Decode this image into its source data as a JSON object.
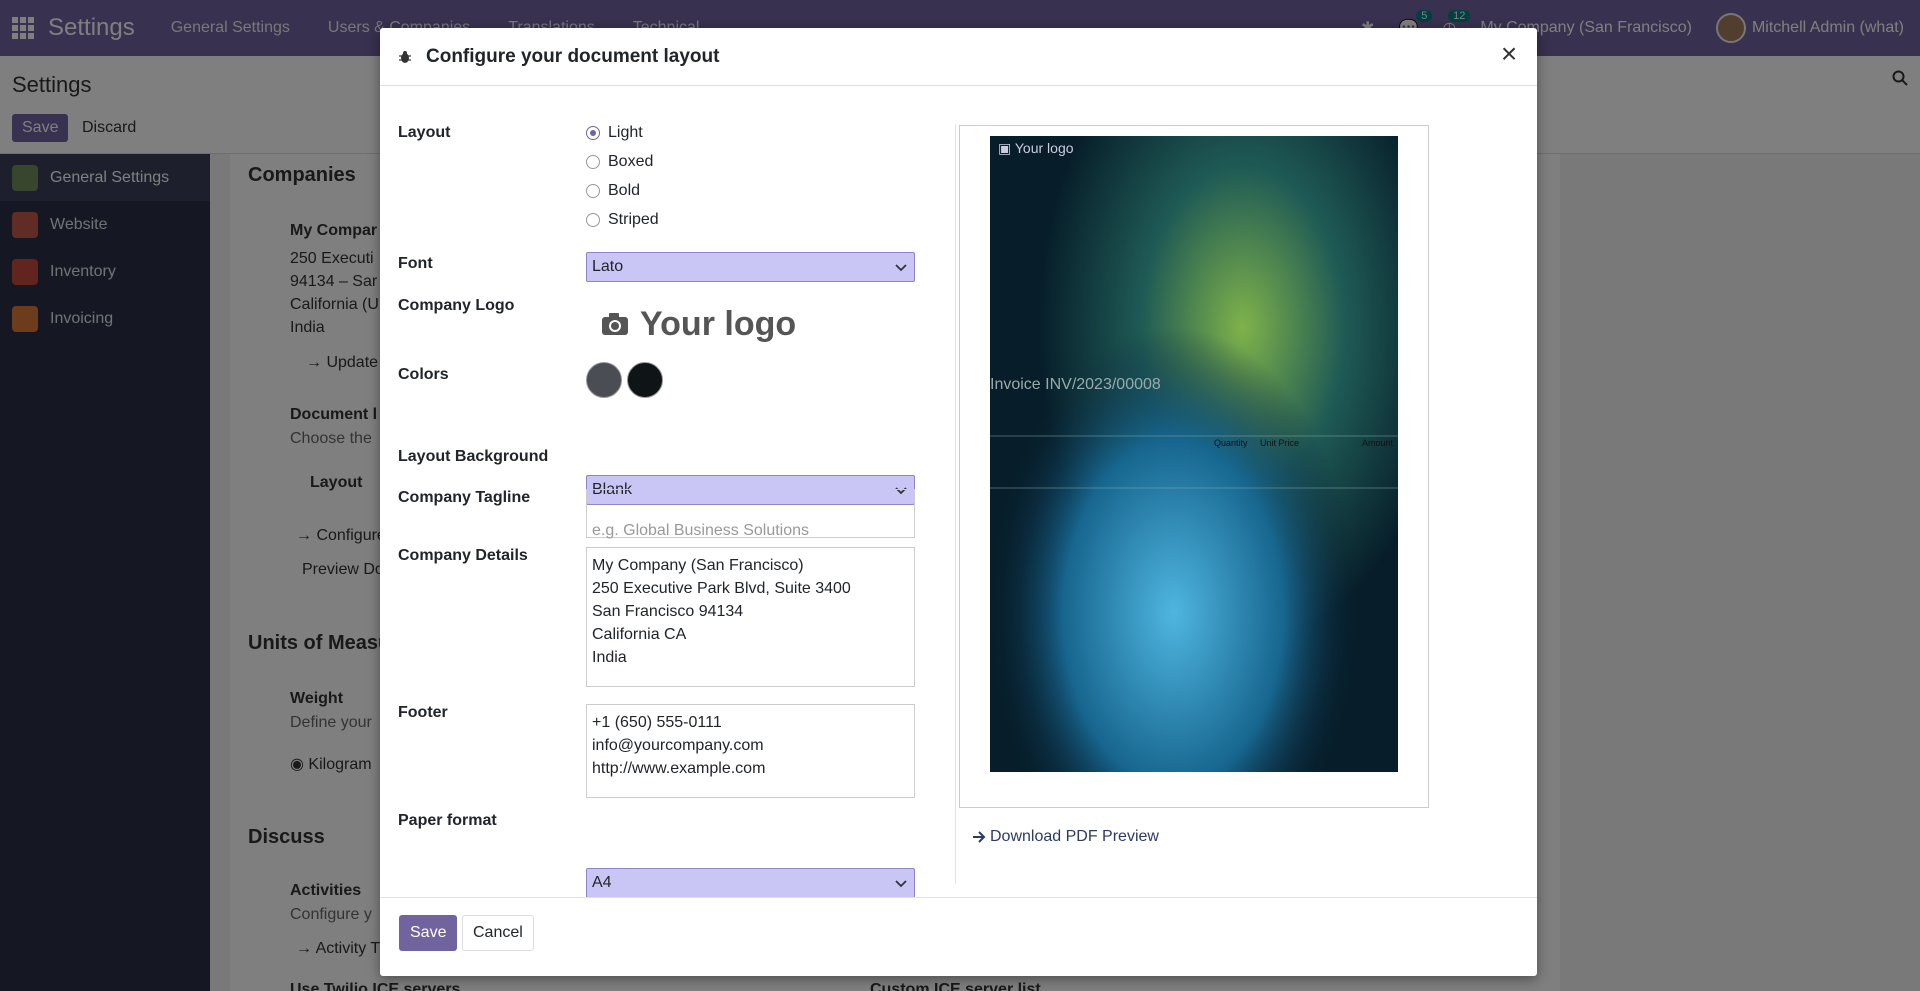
{
  "navbar": {
    "brand": "Settings",
    "menus": [
      "General Settings",
      "Users & Companies",
      "Translations",
      "Technical"
    ],
    "messages_count": "5",
    "activities_count": "12",
    "company": "My Company (San Francisco)",
    "user": "Mitchell Admin (what)"
  },
  "control_panel": {
    "title": "Settings",
    "save_label": "Save",
    "discard_label": "Discard"
  },
  "sidebar": {
    "items": [
      {
        "label": "General Settings",
        "color": "#6e8c5a"
      },
      {
        "label": "Website",
        "color": "#c0584a"
      },
      {
        "label": "Inventory",
        "color": "#c44a3a"
      },
      {
        "label": "Invoicing",
        "color": "#d9783a"
      }
    ]
  },
  "background": {
    "companies_heading": "Companies",
    "company_name": "My Compar",
    "address_lines": [
      "250 Executi",
      "94134 – Sar",
      "California (U",
      "India"
    ],
    "update_link": "Update",
    "doc_layout_title": "Document l",
    "doc_layout_desc": "Choose the",
    "layout_label": "Layout",
    "configure_link": "Configure",
    "preview_link": "Preview Do",
    "units_heading": "Units of Measu",
    "weight_label": "Weight",
    "weight_desc": "Define your",
    "kilogram_label": "Kilogram",
    "discuss_heading": "Discuss",
    "activities_label": "Activities",
    "activities_desc": "Configure y",
    "activity_link": "Activity T",
    "twilio_label": "Use Twilio ICE servers",
    "custom_ice_label": "Custom ICE server list"
  },
  "modal": {
    "title": "Configure your document layout",
    "layout_label": "Layout",
    "layout_options": [
      {
        "label": "Light",
        "selected": true
      },
      {
        "label": "Boxed",
        "selected": false
      },
      {
        "label": "Bold",
        "selected": false
      },
      {
        "label": "Striped",
        "selected": false
      }
    ],
    "font_label": "Font",
    "font_value": "Lato",
    "logo_label": "Company Logo",
    "logo_text": "Your logo",
    "colors_label": "Colors",
    "primary_color": "#4a4d54",
    "secondary_color": "#0f1417",
    "background_label": "Layout Background",
    "background_value": "Blank",
    "tagline_label": "Company Tagline",
    "tagline_placeholder": "e.g. Global Business Solutions",
    "details_label": "Company Details",
    "details_value": "My Company (San Francisco)\n250 Executive Park Blvd, Suite 3400\nSan Francisco 94134\nCalifornia CA\nIndia",
    "footer_label": "Footer",
    "footer_value": "+1 (650) 555-0111\ninfo@yourcompany.com\nhttp://www.example.com",
    "paper_label": "Paper format",
    "paper_value": "A4",
    "preview": {
      "logo_text": "Your logo",
      "invoice_title": "Invoice INV/2023/00008",
      "quantity_header": "Quantity",
      "unit_price_header": "Unit Price",
      "amount_header": "Amount"
    },
    "download_link": "Download PDF Preview",
    "save_label": "Save",
    "cancel_label": "Cancel"
  }
}
